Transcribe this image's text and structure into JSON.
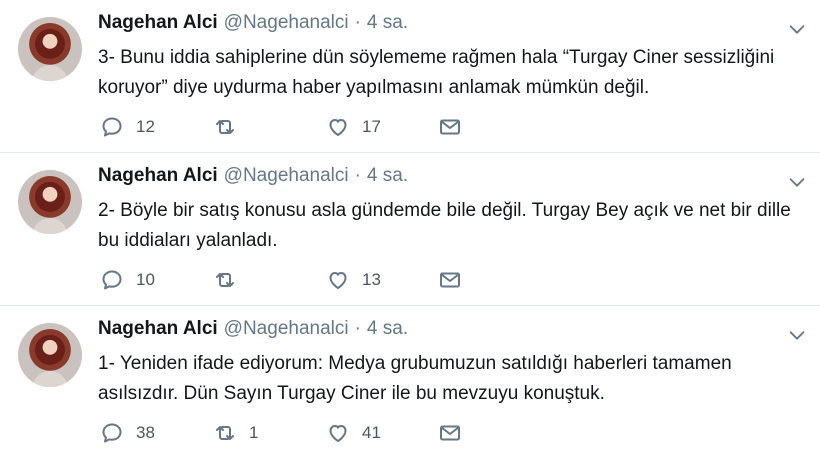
{
  "colors": {
    "text": "#14171a",
    "muted": "#657786",
    "icon": "#657786",
    "divider": "#e1e8ed"
  },
  "tweets": [
    {
      "name": "Nagehan Alci",
      "handle": "@Nagehanalci",
      "separator": "·",
      "time": "4 sa.",
      "text": "3- Bunu iddia sahiplerine dün söylememe rağmen hala “Turgay Ciner sessizliğini koruyor” diye uydurma haber yapılmasını anlamak mümkün değil.",
      "replies": "12",
      "retweets": "",
      "likes": "17"
    },
    {
      "name": "Nagehan Alci",
      "handle": "@Nagehanalci",
      "separator": "·",
      "time": "4 sa.",
      "text": "2- Böyle bir satış konusu asla gündemde bile değil. Turgay Bey açık ve net bir dille bu iddiaları yalanladı.",
      "replies": "10",
      "retweets": "",
      "likes": "13"
    },
    {
      "name": "Nagehan Alci",
      "handle": "@Nagehanalci",
      "separator": "·",
      "time": "4 sa.",
      "text": "1- Yeniden ifade ediyorum: Medya grubumuzun satıldığı haberleri tamamen asılsızdır. Dün Sayın Turgay Ciner ile bu mevzuyu konuştuk.",
      "replies": "38",
      "retweets": "1",
      "likes": "41"
    }
  ]
}
